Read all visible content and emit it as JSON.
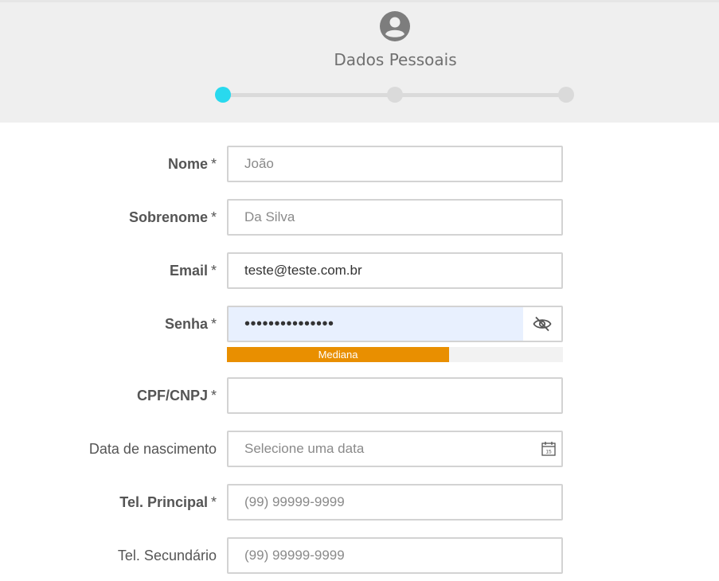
{
  "header": {
    "icon": "user-circle-icon",
    "title": "Dados Pessoais",
    "steps": 3,
    "active_step": 1,
    "active_color": "#29d9ee"
  },
  "form": {
    "nome": {
      "label": "Nome",
      "required": "*",
      "placeholder": "João",
      "value": ""
    },
    "sobrenome": {
      "label": "Sobrenome",
      "required": "*",
      "placeholder": "Da Silva",
      "value": ""
    },
    "email": {
      "label": "Email",
      "required": "*",
      "placeholder": "",
      "value": "teste@teste.com.br"
    },
    "senha": {
      "label": "Senha",
      "required": "*",
      "value": "•••••••••••••••",
      "toggle_icon": "eye-off-icon",
      "strength": {
        "label": "Mediana",
        "level": 0.66,
        "color": "#e98f00"
      }
    },
    "cpf": {
      "label": "CPF/CNPJ",
      "required": "*",
      "placeholder": "",
      "value": ""
    },
    "nascimento": {
      "label": "Data de nascimento",
      "placeholder": "Selecione uma data",
      "icon": "calendar-icon",
      "calendar_day": "15"
    },
    "tel_principal": {
      "label": "Tel. Principal",
      "required": "*",
      "placeholder": "(99) 99999-9999"
    },
    "tel_secundario": {
      "label": "Tel. Secundário",
      "placeholder": "(99) 99999-9999"
    }
  }
}
